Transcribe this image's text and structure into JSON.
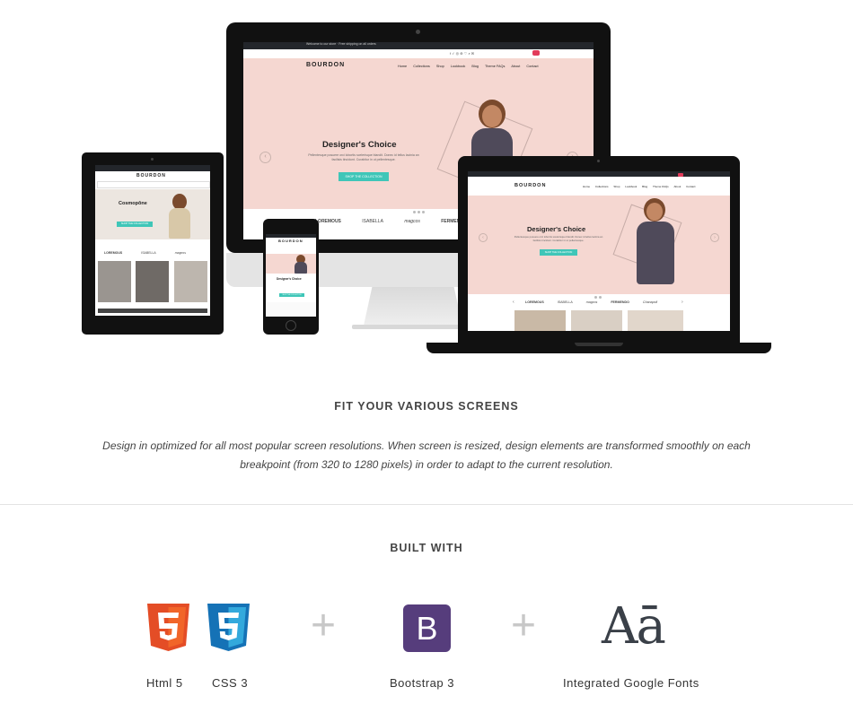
{
  "mockup": {
    "topbar_text": "Welcome to our store · Free shipping on all orders",
    "logo": "BOURDON",
    "nav": [
      "Home",
      "Collections",
      "Shop",
      "Lookbook",
      "Blog",
      "Theme FAQs",
      "About",
      "Contact"
    ],
    "hero_title": "Designer's Choice",
    "hero_text": "Pellentesque posuere orci lobortis scelerisque blandit. Donec id tellus lacinia an facilisis tincidunt. Curabitur in ut pellentesque.",
    "hero_button": "SHOP THE COLLECTION",
    "tablet_hero_title": "Cosmopône",
    "brands": [
      "LOREMOUS",
      "ISABELLA",
      "magcos",
      "FERMENDO",
      "Chanapoll"
    ],
    "cart_count": "0"
  },
  "fit": {
    "title": "FIT YOUR VARIOUS SCREENS",
    "description_line1": "Design in optimized for all most popular screen resolutions. When screen is resized, design elements are transformed smoothly on each",
    "description_line2": "breakpoint (from 320 to 1280 pixels) in order to adapt to the current resolution."
  },
  "built": {
    "title": "BUILT WITH",
    "items": [
      {
        "label": "Html 5",
        "icon": "html5-icon",
        "color": "#e44d26"
      },
      {
        "label": "CSS 3",
        "icon": "css3-icon",
        "color": "#1572b6"
      },
      {
        "label": "Bootstrap 3",
        "icon": "bootstrap-icon",
        "color": "#563d7c"
      },
      {
        "label": "Integrated Google Fonts",
        "icon": "google-fonts-icon",
        "glyph": "Aā",
        "color": "#3a4048"
      }
    ],
    "plus": "+"
  }
}
